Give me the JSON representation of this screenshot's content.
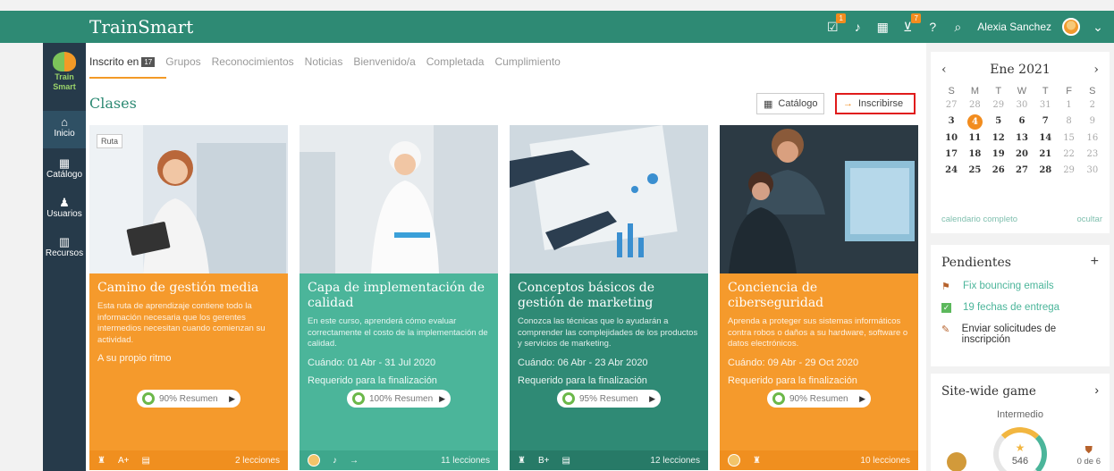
{
  "header": {
    "brand": "TrainSmart",
    "user_name": "Alexia Sanchez",
    "badges": {
      "notifications": "1",
      "cart": "7"
    },
    "icons": [
      "check-board-icon",
      "bell-icon",
      "calendar-icon",
      "cart-icon",
      "help-icon",
      "search-icon",
      "user-avatar-icon",
      "chevron-down-icon"
    ]
  },
  "sidebar": {
    "logo_text": [
      "Train",
      "Smart"
    ],
    "items": [
      {
        "label": "Inicio",
        "icon": "home-icon",
        "glyph": "⌂"
      },
      {
        "label": "Catálogo",
        "icon": "grid-icon",
        "glyph": "▦"
      },
      {
        "label": "Usuarios",
        "icon": "user-icon",
        "glyph": "♟"
      },
      {
        "label": "Recursos",
        "icon": "books-icon",
        "glyph": "▥"
      }
    ]
  },
  "tabs": [
    {
      "label": "Inscrito en",
      "count": "17"
    },
    {
      "label": "Grupos"
    },
    {
      "label": "Reconocimientos"
    },
    {
      "label": "Noticias"
    },
    {
      "label": "Bienvenido/a"
    },
    {
      "label": "Completada"
    },
    {
      "label": "Cumplimiento"
    }
  ],
  "section": {
    "title": "Clases",
    "catalog_label": "Catálogo",
    "enroll_label": "Inscribirse"
  },
  "cards": [
    {
      "tag": "Ruta",
      "title": "Camino de gestión media",
      "desc": "Esta ruta de aprendizaje contiene todo la información necesaria que los gerentes intermedios necesitan cuando comienzan su actividad.",
      "when": "A su propio ritmo",
      "req": "",
      "progress": "90% Resumen",
      "progress_value": 90,
      "foot_icons": [
        "trophy-icon",
        "grade-icon",
        "document-icon"
      ],
      "grade": "A+",
      "lessons": "2 lecciones"
    },
    {
      "title": "Capa de implementación de calidad",
      "desc": "En este curso, aprenderá cómo evaluar correctamente el costo de la implementación de calidad.",
      "when": "Cuándo: 01 Abr - 31 Jul 2020",
      "req": "Requerido para la finalización",
      "progress": "100% Resumen",
      "progress_value": 100,
      "lessons": "11 lecciones"
    },
    {
      "title": "Conceptos básicos de gestión de marketing",
      "desc": "Conozca las técnicas que lo ayudarán a comprender las complejidades de los productos y servicios de marketing.",
      "when": "Cuándo: 06 Abr - 23 Abr 2020",
      "req": "Requerido para la finalización",
      "progress": "95% Resumen",
      "progress_value": 95,
      "grade": "B+",
      "lessons": "12 lecciones"
    },
    {
      "title": "Conciencia de ciberseguridad",
      "desc": "Aprenda a proteger sus sistemas informáticos contra robos o daños a su hardware, software o datos electrónicos.",
      "when": "Cuándo: 09 Abr - 29 Oct 2020",
      "req": "Requerido para la finalización",
      "progress": "90% Resumen",
      "progress_value": 90,
      "lessons": "10 lecciones"
    }
  ],
  "calendar": {
    "month": "Ene 2021",
    "dow": [
      "S",
      "M",
      "T",
      "W",
      "T",
      "F",
      "S"
    ],
    "weeks": [
      [
        "27",
        "28",
        "29",
        "30",
        "31",
        "1",
        "2"
      ],
      [
        "3",
        "4",
        "5",
        "6",
        "7",
        "8",
        "9"
      ],
      [
        "10",
        "11",
        "12",
        "13",
        "14",
        "15",
        "16"
      ],
      [
        "17",
        "18",
        "19",
        "20",
        "21",
        "22",
        "23"
      ],
      [
        "24",
        "25",
        "26",
        "27",
        "28",
        "29",
        "30"
      ]
    ],
    "today": "4",
    "full_link": "calendario completo",
    "hide_link": "ocultar"
  },
  "pending": {
    "title": "Pendientes",
    "items": [
      {
        "label": "Fix bouncing emails",
        "icon": "flag-icon"
      },
      {
        "label": "19 fechas de entrega",
        "icon": "checkbox-icon"
      },
      {
        "label": "Enviar solicitudes de inscripción",
        "icon": "pin-icon"
      }
    ]
  },
  "game": {
    "title": "Site-wide game",
    "level": "Intermedio",
    "score": "546",
    "badges": "0 de 6"
  },
  "colors": {
    "brand": "#2e8a74",
    "sidebar": "#263a4a",
    "accent": "#f28c1e",
    "orange": "#f59a2c",
    "teal": "#4bb59a"
  }
}
